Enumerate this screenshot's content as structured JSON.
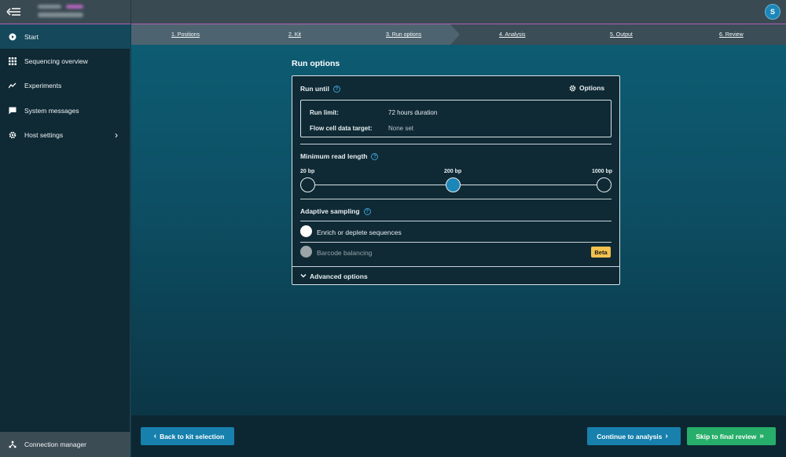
{
  "app": {
    "user_initial": "S"
  },
  "sidebar": {
    "items": [
      {
        "label": "Start",
        "icon": "play-circle-icon"
      },
      {
        "label": "Sequencing overview",
        "icon": "grid-icon"
      },
      {
        "label": "Experiments",
        "icon": "activity-icon"
      },
      {
        "label": "System messages",
        "icon": "message-icon"
      },
      {
        "label": "Host settings",
        "icon": "gear-icon"
      }
    ],
    "connection_manager": "Connection manager"
  },
  "steps": [
    "1. Positions",
    "2. Kit",
    "3. Run options",
    "4. Analysis",
    "5. Output",
    "6. Review"
  ],
  "run_options": {
    "title": "Run options",
    "run_until": {
      "label": "Run until",
      "options_label": "Options",
      "run_limit_key": "Run limit:",
      "run_limit_value": "72 hours duration",
      "flow_cell_key": "Flow cell data target:",
      "flow_cell_value": "None set"
    },
    "min_read_length": {
      "label": "Minimum read length",
      "ticks": [
        "20 bp",
        "200 bp",
        "1000 bp"
      ],
      "selected": "200 bp"
    },
    "adaptive_sampling": {
      "label": "Adaptive sampling",
      "option_enrich": "Enrich or deplete sequences",
      "option_barcode": "Barcode balancing",
      "beta_badge": "Beta"
    },
    "advanced_label": "Advanced options"
  },
  "footer": {
    "back_label": "Back to kit selection",
    "continue_label": "Continue to analysis",
    "skip_label": "Skip to final review"
  },
  "colors": {
    "accent_blue": "#1780ac",
    "skip_green": "#27ae6a",
    "beta_yellow": "#f2c14e",
    "topbar_accent": "#b05fb8"
  }
}
